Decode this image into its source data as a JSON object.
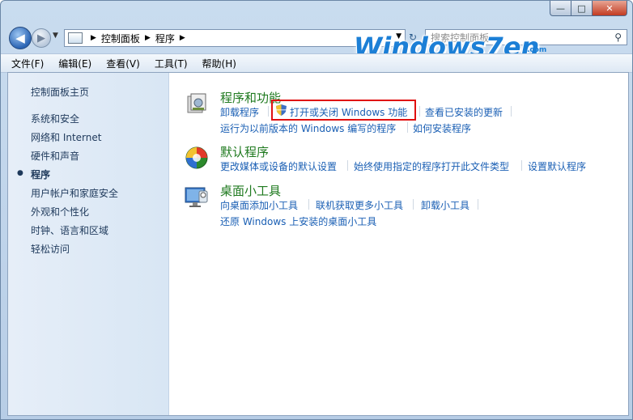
{
  "window": {
    "caption_buttons": {
      "minimize": "—",
      "maximize": "□",
      "close": "✕"
    }
  },
  "navigation": {
    "back_glyph": "◀",
    "forward_glyph": "▶",
    "breadcrumb": [
      "控制面板",
      "程序"
    ],
    "search_placeholder": "搜索控制面板",
    "icons": [
      "back-arrow-icon",
      "forward-arrow-icon",
      "control-panel-icon",
      "refresh-icon",
      "search-icon"
    ]
  },
  "watermark": {
    "logo_text": "Windows7en",
    "logo_sub": ".com"
  },
  "menu": [
    "文件(F)",
    "编辑(E)",
    "查看(V)",
    "工具(T)",
    "帮助(H)"
  ],
  "sidebar": {
    "items": [
      {
        "label": "控制面板主页",
        "selected": false
      },
      {
        "label": "系统和安全",
        "selected": false
      },
      {
        "label": "网络和 Internet",
        "selected": false
      },
      {
        "label": "硬件和声音",
        "selected": false
      },
      {
        "label": "程序",
        "selected": true
      },
      {
        "label": "用户帐户和家庭安全",
        "selected": false
      },
      {
        "label": "外观和个性化",
        "selected": false
      },
      {
        "label": "时钟、语言和区域",
        "selected": false
      },
      {
        "label": "轻松访问",
        "selected": false
      }
    ]
  },
  "sections": [
    {
      "title": "程序和功能",
      "icon": "programs-features-icon",
      "links": [
        "卸载程序",
        "打开或关闭 Windows 功能",
        "查看已安装的更新",
        "运行为以前版本的 Windows 编写的程序",
        "如何安装程序"
      ]
    },
    {
      "title": "默认程序",
      "icon": "default-programs-icon",
      "links": [
        "更改媒体或设备的默认设置",
        "始终使用指定的程序打开此文件类型",
        "设置默认程序"
      ]
    },
    {
      "title": "桌面小工具",
      "icon": "desktop-gadgets-icon",
      "links": [
        "向桌面添加小工具",
        "联机获取更多小工具",
        "卸载小工具",
        "还原 Windows 上安装的桌面小工具"
      ]
    }
  ],
  "colors": {
    "link": "#1a5fb4",
    "section_title": "#1f7a1f",
    "highlight": "#e01010",
    "sidebar_bg": "#dde8f4"
  }
}
